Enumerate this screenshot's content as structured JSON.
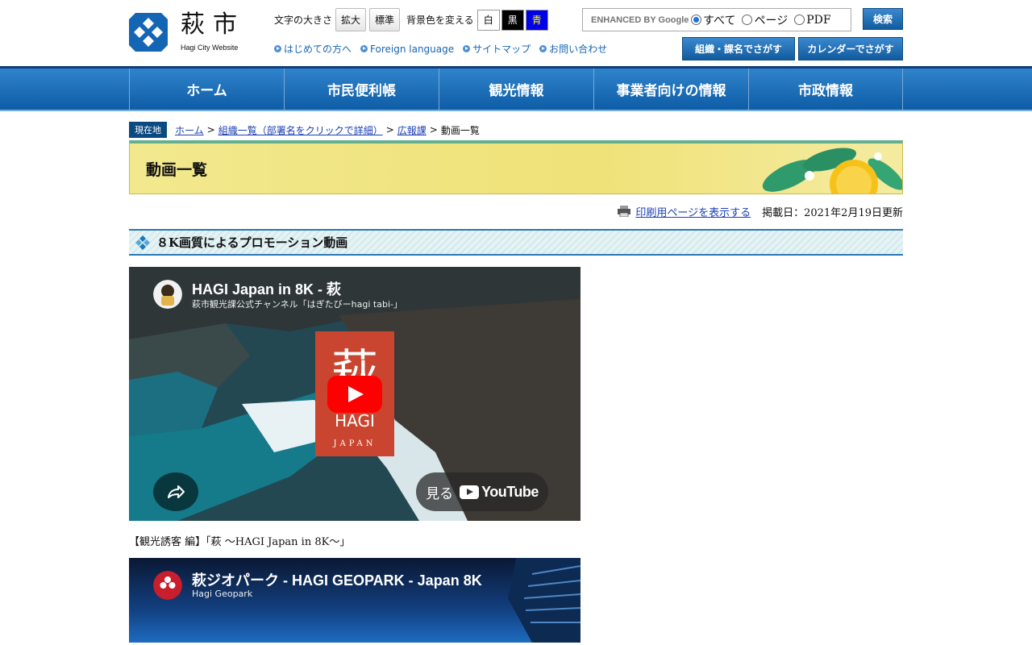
{
  "header": {
    "logo_kanji": "萩市",
    "logo_sub": "Hagi City Website",
    "font_size_label": "文字の大きさ",
    "font_enlarge": "拡大",
    "font_standard": "標準",
    "bg_color_label": "背景色を変える",
    "bg_white": "白",
    "bg_black": "黒",
    "bg_blue": "青",
    "links": [
      "はじめての方へ",
      "Foreign language",
      "サイトマップ",
      "お問い合わせ"
    ],
    "search_placeholder": "ENHANCED BY Google",
    "search_options": [
      "すべて",
      "ページ",
      "PDF"
    ],
    "search_button": "検索",
    "org_button": "組織・課名でさがす",
    "calendar_button": "カレンダーでさがす"
  },
  "nav": [
    "ホーム",
    "市民便利帳",
    "観光情報",
    "事業者向けの情報",
    "市政情報"
  ],
  "breadcrumb": {
    "tag": "現在地",
    "items": [
      "ホーム",
      "組織一覧（部署名をクリックで詳細）",
      "広報課"
    ],
    "current": "動画一覧"
  },
  "page": {
    "title": "動画一覧",
    "print_link": "印刷用ページを表示する",
    "date": "掲載日：2021年2月19日更新",
    "section_title": "８K画質によるプロモーション動画"
  },
  "videos": [
    {
      "title": "HAGI Japan in 8K - 萩",
      "channel": "萩市観光課公式チャンネル「はぎたびーhagi tabi-」",
      "center_kanji": "萩",
      "center_en": "HAGI",
      "center_sub": "JAPAN",
      "watch_label": "見る",
      "yt_label": "YouTube",
      "caption": "【観光誘客 編】「萩 ～HAGI Japan in 8K～」"
    },
    {
      "title": "萩ジオパーク - HAGI GEOPARK - Japan 8K",
      "channel": "Hagi Geopark"
    }
  ]
}
